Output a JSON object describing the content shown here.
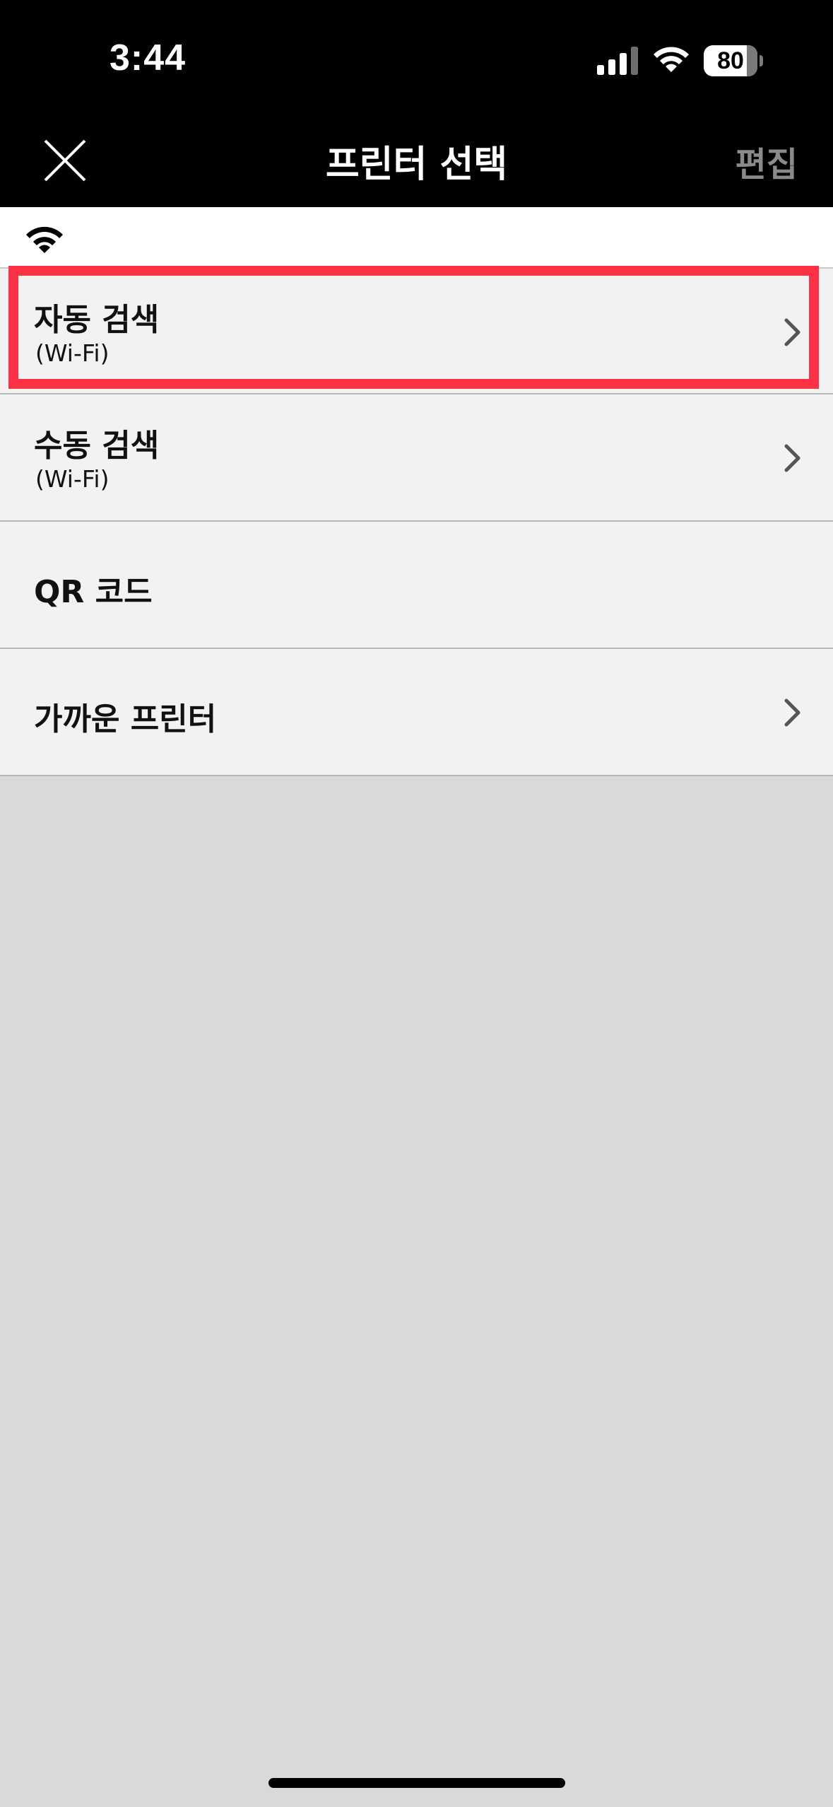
{
  "status_bar": {
    "time": "3:44",
    "battery_level": "80",
    "battery_fraction": 0.8
  },
  "nav": {
    "title": "프린터 선택",
    "edit_label": "편집",
    "close_icon": "close-icon"
  },
  "connection": {
    "icon": "wifi-icon"
  },
  "menu": {
    "items": [
      {
        "title": "자동 검색",
        "subtitle": "(Wi-Fi)",
        "chevron": true,
        "highlighted": true
      },
      {
        "title": "수동 검색",
        "subtitle": "(Wi-Fi)",
        "chevron": true,
        "highlighted": false
      },
      {
        "title": "QR 코드",
        "subtitle": "",
        "chevron": false,
        "highlighted": false
      },
      {
        "title": "가까운 프린터",
        "subtitle": "",
        "chevron": true,
        "highlighted": false
      }
    ]
  },
  "colors": {
    "highlight": "#ff3146",
    "nav_background": "#000000",
    "list_background": "#f2f2f2",
    "page_background": "#d9d9d9",
    "edit_text": "#8a8a8a"
  }
}
